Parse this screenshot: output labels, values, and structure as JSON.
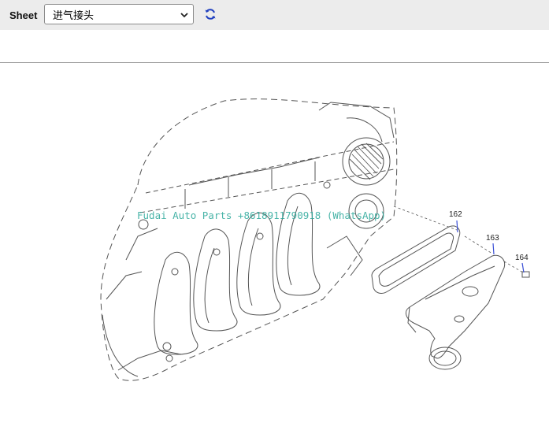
{
  "toolbar": {
    "sheet_label": "Sheet",
    "sheet_value": "进气接头",
    "refresh_icon": "refresh-icon",
    "chevron_icon": "chevron-down-icon"
  },
  "diagram": {
    "callouts": [
      "162",
      "163",
      "164"
    ],
    "watermark": "Fudai Auto Parts +8618911790918 (WhatsApp)"
  },
  "colors": {
    "toolbar_bg": "#ececec",
    "refresh_blue": "#1f3fbf",
    "leader_blue": "#3a4fd6",
    "watermark": "#2aa89a",
    "line": "#555555"
  }
}
